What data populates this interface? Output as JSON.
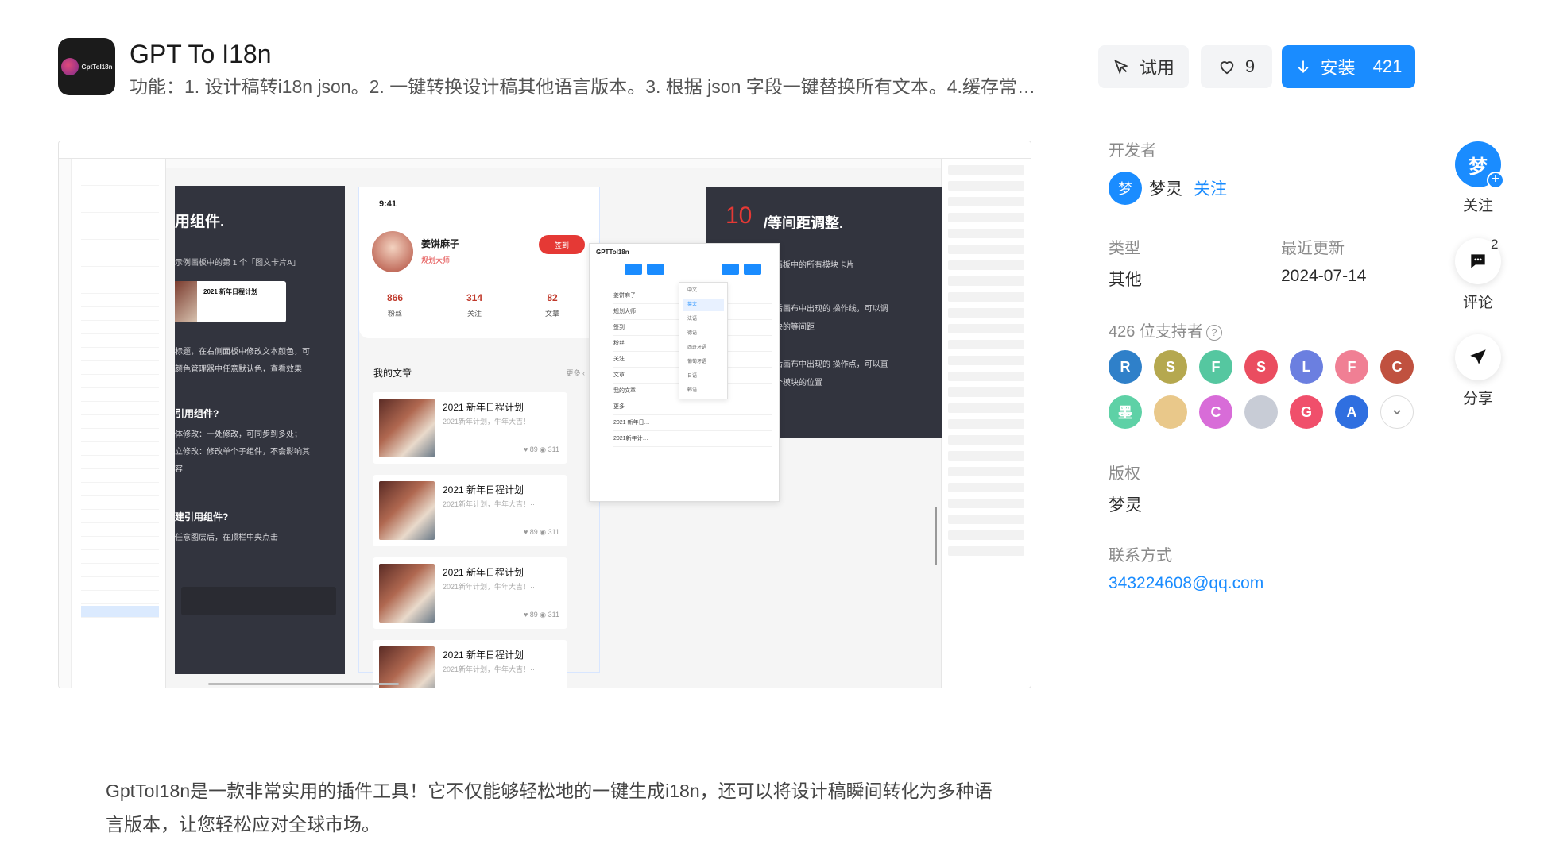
{
  "app": {
    "logo_text": "GptToI18n",
    "title": "GPT To I18n",
    "description": "功能：1. 设计稿转i18n json。2. 一键转换设计稿其他语言版本。3. 根据 json 字段一键替换所有文本。4.缓存常…"
  },
  "actions": {
    "try_label": "试用",
    "like_count": "9",
    "install_label": "安装",
    "install_count": "421"
  },
  "preview": {
    "card1_title": "用组件.",
    "card1_sub": "示例画板中的第 1 个「图文卡片A」",
    "card1_line1": "标题，在右侧面板中修改文本颜色，可",
    "card1_line2": "颜色管理器中任意默认色，查看效果",
    "card1_q1": "引用组件?",
    "card1_q1a": "体修改：一处修改，可同步到多处；",
    "card1_q1b": "立修改：修改单个子组件，不会影响其",
    "card1_q1c": "容",
    "card1_q2": "建引用组件?",
    "card1_q2a": "任意图层后，在顶栏中央点击",
    "mini_title": "2021 新年日程计划",
    "phone_time": "9:41",
    "phone_name": "姜饼麻子",
    "phone_role": "规划大师",
    "phone_sign": "签到",
    "stats": [
      {
        "value": "866",
        "label": "粉丝"
      },
      {
        "value": "314",
        "label": "关注"
      },
      {
        "value": "82",
        "label": "文章"
      }
    ],
    "section_title": "我的文章",
    "section_more": "更多 ‹",
    "articles": [
      {
        "title": "2021 新年日程计划",
        "sub": "2021新年计划，牛年大吉！···",
        "meta": "♥ 89   ◉ 311"
      },
      {
        "title": "2021 新年日程计划",
        "sub": "2021新年计划，牛年大吉！···",
        "meta": "♥ 89   ◉ 311"
      },
      {
        "title": "2021 新年日程计划",
        "sub": "2021新年计划，牛年大吉！···",
        "meta": "♥ 89   ◉ 311"
      },
      {
        "title": "2021 新年日程计划",
        "sub": "2021新年计划，牛年大吉！···",
        "meta": ""
      }
    ],
    "card2_num": "10",
    "card2_title": "/等间距调整.",
    "card2_l1": "画板中的所有模块卡片",
    "card2_l2": "后画布中出现的 操作线，可以调",
    "card2_l3": "块的等间距",
    "card2_l4": "后画布中出现的 操作点，可以直",
    "card2_l5": "个模块的位置",
    "plugin_title": "GPTToI18n",
    "plugin_rows": [
      "姜饼麻子",
      "规划大师",
      "签到",
      "粉丝",
      "关注",
      "文章",
      "我的文章",
      "更多",
      "2021 新年日…",
      "2021新年计…"
    ],
    "dropdown": [
      "中文",
      "英文",
      "法语",
      "德语",
      "西班牙语",
      "葡萄牙语",
      "日语",
      "韩语"
    ]
  },
  "info": {
    "developer_label": "开发者",
    "developer_initial": "梦",
    "developer_name": "梦灵",
    "follow_label": "关注",
    "type_label": "类型",
    "type_value": "其他",
    "updated_label": "最近更新",
    "updated_value": "2024-07-14",
    "supporters_label": "426 位支持者",
    "supporters": [
      {
        "letter": "R",
        "color": "#2f80c9"
      },
      {
        "letter": "S",
        "color": "#b5a84f"
      },
      {
        "letter": "F",
        "color": "#55c7a0"
      },
      {
        "letter": "S",
        "color": "#ea4d60"
      },
      {
        "letter": "L",
        "color": "#6b7fe0"
      },
      {
        "letter": "F",
        "color": "#f07f94"
      },
      {
        "letter": "C",
        "color": "#c0513f"
      },
      {
        "letter": "墨",
        "color": "#5ed1a6"
      },
      {
        "letter": "",
        "color": "#e9c88a"
      },
      {
        "letter": "C",
        "color": "#d86cd8"
      },
      {
        "letter": "",
        "color": "#c8ccd6"
      },
      {
        "letter": "G",
        "color": "#f04f6b"
      },
      {
        "letter": "A",
        "color": "#2f6fe0"
      }
    ],
    "copyright_label": "版权",
    "copyright_value": "梦灵",
    "contact_label": "联系方式",
    "contact_value": "343224608@qq.com"
  },
  "rail": {
    "follow_initial": "梦",
    "follow_label": "关注",
    "comment_count": "2",
    "comment_label": "评论",
    "share_label": "分享"
  },
  "long_description": "GptToI18n是一款非常实用的插件工具！它不仅能够轻松地的一键生成i18n，还可以将设计稿瞬间转化为多种语言版本，让您轻松应对全球市场。"
}
